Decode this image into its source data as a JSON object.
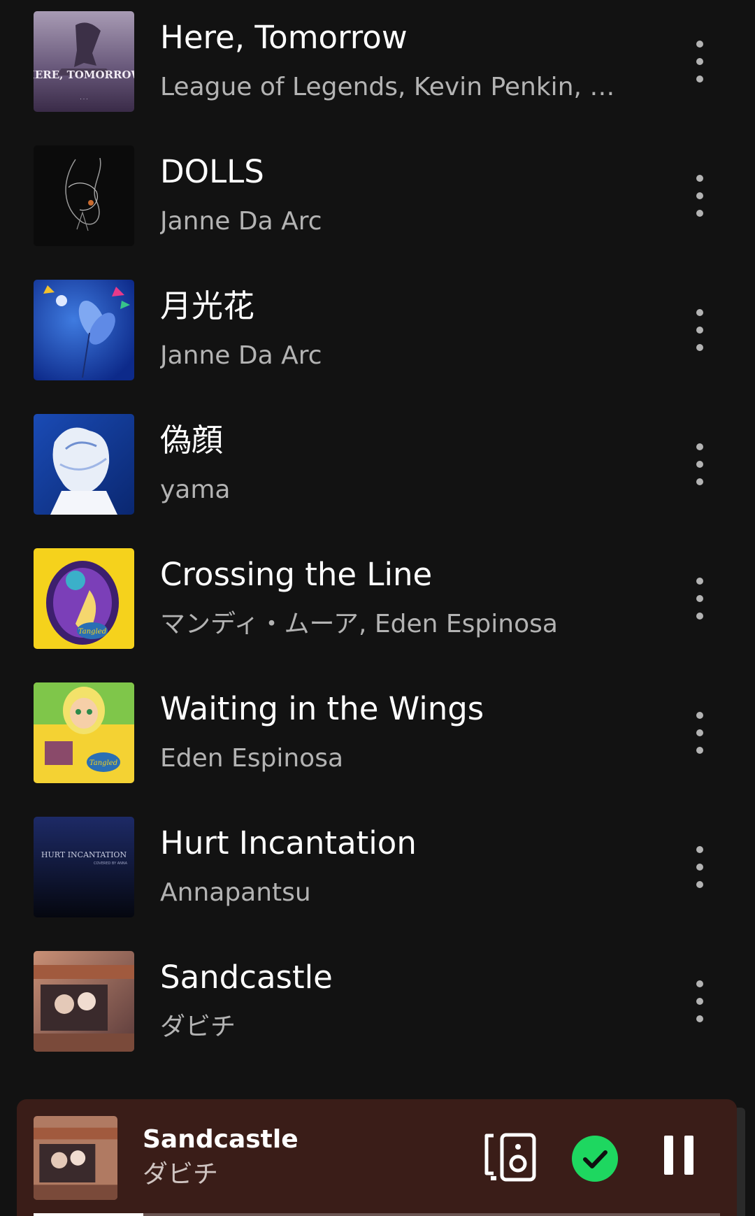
{
  "tracks": [
    {
      "title": "Here, Tomorrow",
      "artist": "League of Legends, Kevin Penkin, 幾…",
      "cover_icon": "album-art-here-tomorrow",
      "cover_text": "HERE, TOMORROW"
    },
    {
      "title": "DOLLS",
      "artist": "Janne Da Arc",
      "cover_icon": "album-art-dolls"
    },
    {
      "title": "月光花",
      "artist": "Janne Da Arc",
      "cover_icon": "album-art-gekkouka"
    },
    {
      "title": "偽顔",
      "artist": "yama",
      "cover_icon": "album-art-nisegao"
    },
    {
      "title": "Crossing the Line",
      "artist": "マンディ・ムーア, Eden Espinosa",
      "cover_icon": "album-art-crossing-the-line",
      "cover_text": "Tangled"
    },
    {
      "title": "Waiting in the Wings",
      "artist": "Eden Espinosa",
      "cover_icon": "album-art-waiting-in-the-wings",
      "cover_text": "Tangled"
    },
    {
      "title": "Hurt Incantation",
      "artist": "Annapantsu",
      "cover_icon": "album-art-hurt-incantation",
      "cover_text": "HURT INCANTATION",
      "cover_subtext": "COVERED BY ANNA"
    },
    {
      "title": "Sandcastle",
      "artist": "ダビチ",
      "cover_icon": "album-art-sandcastle"
    }
  ],
  "now_playing": {
    "title": "Sandcastle",
    "artist": "ダビチ",
    "progress": 0.16,
    "device_icon": "connect-device-icon",
    "added_icon": "added-check-icon",
    "pause_icon": "pause-icon"
  },
  "colors": {
    "background": "#121212",
    "mini_player": "#3a1d18",
    "accent_green": "#1ed760",
    "secondary_text": "#b3b3b3"
  }
}
